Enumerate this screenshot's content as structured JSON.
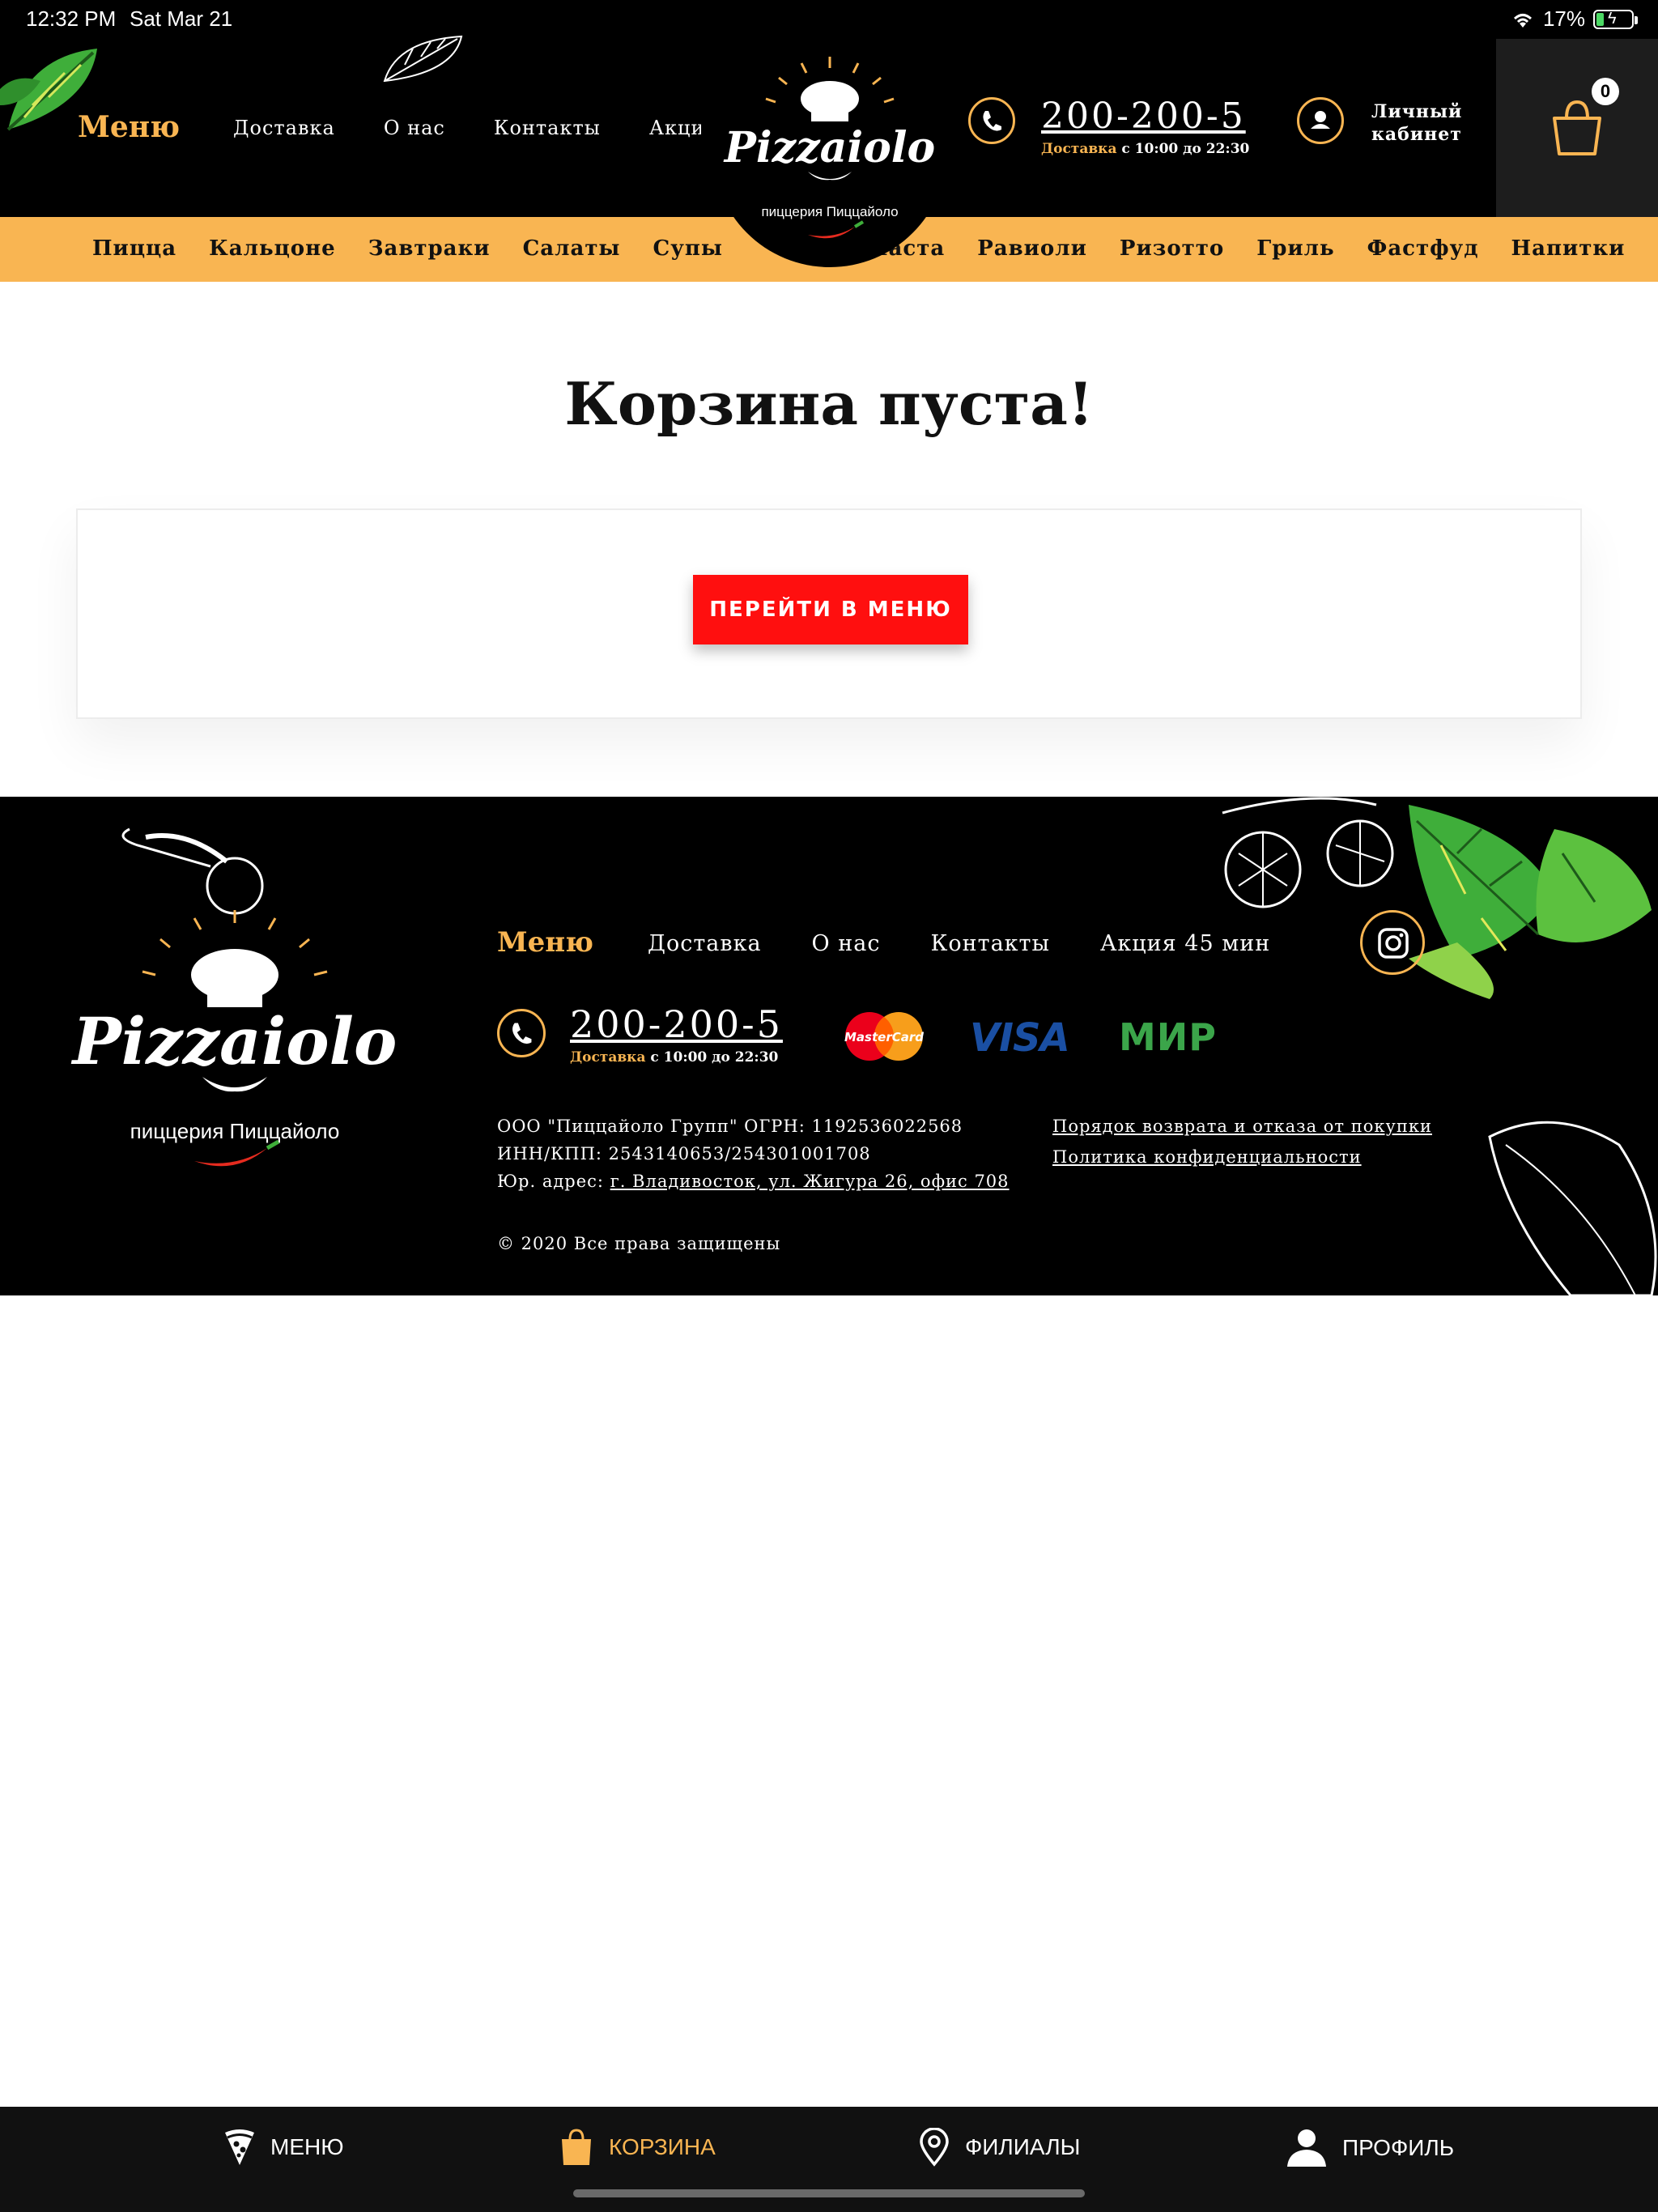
{
  "status_bar": {
    "time": "12:32 PM",
    "date": "Sat Mar 21",
    "battery": "17%"
  },
  "header": {
    "menu_label": "Меню",
    "nav": [
      "Доставка",
      "О нас",
      "Контакты",
      "Акция"
    ],
    "logo_text": "Pizzaiolo",
    "logo_sub": "пиццерия Пиццайоло",
    "phone": "200-200-5",
    "delivery_label": "Доставка",
    "delivery_hours": "с 10:00 до 22:30",
    "account_label": "Личный кабинет",
    "cart_count": "0"
  },
  "categories_left": [
    "Пицца",
    "Кальцоне",
    "Завтраки",
    "Салаты",
    "Супы"
  ],
  "categories_right": [
    "Паста",
    "Равиоли",
    "Ризотто",
    "Гриль",
    "Фастфуд",
    "Напитки"
  ],
  "main": {
    "title": "Корзина пуста!",
    "button": "ПЕРЕЙТИ В МЕНЮ"
  },
  "footer": {
    "menu_label": "Меню",
    "nav": [
      "Доставка",
      "О нас",
      "Контакты",
      "Акция 45 мин"
    ],
    "phone": "200-200-5",
    "delivery_label": "Доставка",
    "delivery_hours": "с 10:00 до 22:30",
    "payments": {
      "mastercard": "MasterCard",
      "visa": "VISA",
      "mir": "МИР"
    },
    "legal_1": "ООО \"Пиццайоло Групп\" ОГРН: 1192536022568",
    "legal_2": "ИНН/КПП: 2543140653/254301001708",
    "legal_3_prefix": "Юр. адрес: ",
    "legal_3_address": "г. Владивосток, ул. Жигура 26, офис 708",
    "policy_return": "Порядок возврата и отказа от покупки",
    "policy_privacy": "Политика конфиденциальности",
    "copyright": "© 2020 Все права защищены",
    "logo_text": "Pizzaiolo",
    "logo_sub": "пиццерия Пиццайоло"
  },
  "tabbar": {
    "items": [
      {
        "label": "МЕНЮ",
        "icon": "pizza-slice-icon"
      },
      {
        "label": "КОРЗИНА",
        "icon": "shopping-bag-icon"
      },
      {
        "label": "ФИЛИАЛЫ",
        "icon": "map-pin-icon"
      },
      {
        "label": "ПРОФИЛЬ",
        "icon": "user-icon"
      }
    ],
    "active_index": 1
  },
  "colors": {
    "accent": "#f9b552",
    "button": "#ff0f0f",
    "background_dark": "#000000"
  }
}
